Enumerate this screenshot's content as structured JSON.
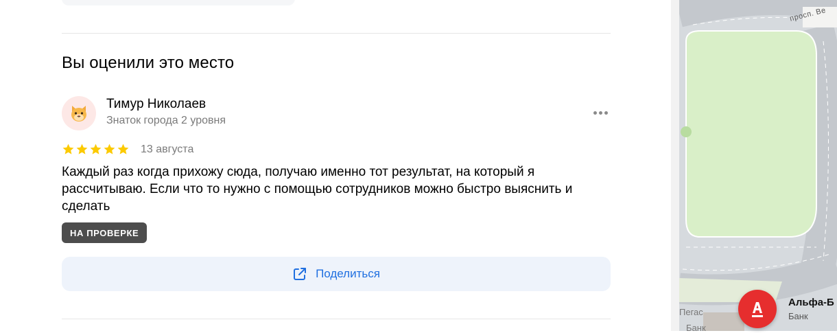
{
  "review_section": {
    "title": "Вы оценили это место",
    "author": {
      "name": "Тимур Николаев",
      "level": "Знаток города 2 уровня",
      "avatar_icon": "cat-face-icon"
    },
    "rating": 5,
    "rating_max": 5,
    "date": "13 августа",
    "text": "Каждый раз когда прихожу сюда, получаю именно тот результат, на который я рассчитываю. Если что то нужно с помощью сотрудников можно быстро выяснить и сделать",
    "status_badge": "НА ПРОВЕРКЕ",
    "share_label": "Поделиться",
    "more_icon": "more-dots-icon",
    "share_icon": "share-icon"
  },
  "map": {
    "road_label": "просп. Ве",
    "poi_name": "Альфа-Б",
    "poi_type": "Банк",
    "poi_icon_letter": "А",
    "nearby_label_1": "Пегас",
    "nearby_label_2": "Банк"
  },
  "colors": {
    "accent_blue": "#1f6fe0",
    "star_yellow": "#fcca00",
    "badge_bg": "#4d4d4d",
    "poi_red": "#e62e2e",
    "park_green": "#d9efc8"
  }
}
